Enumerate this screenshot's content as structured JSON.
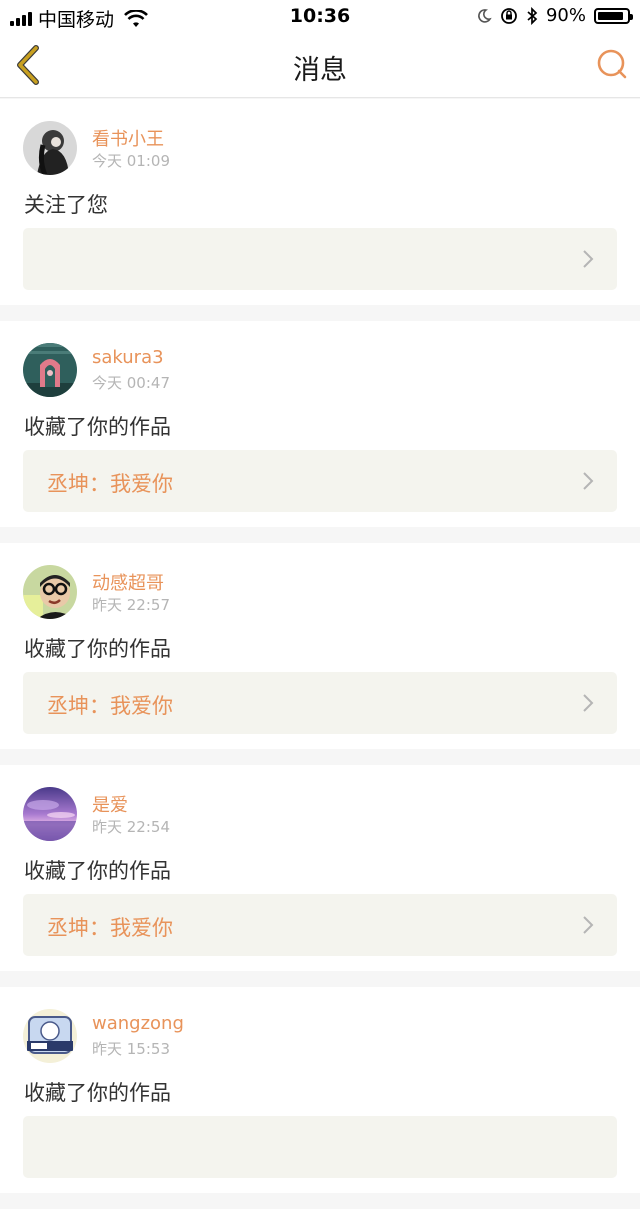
{
  "status_bar": {
    "carrier": "中国移动",
    "time": "10:36",
    "battery_percent_label": "90%",
    "battery_level": 0.9
  },
  "nav": {
    "title": "消息",
    "back_icon": "chevron-left-icon",
    "search_icon": "search-icon"
  },
  "colors": {
    "accent": "#e8935a",
    "back_icon": "#c8a020",
    "quote_bg": "#f4f4ee"
  },
  "messages": [
    {
      "username": "看书小王",
      "time": "今天 01:09",
      "action": "关注了您",
      "quote": ""
    },
    {
      "username": "sakura3",
      "time": "今天 00:47",
      "action": "收藏了你的作品",
      "quote": "丞坤：我爱你"
    },
    {
      "username": "动感超哥",
      "time": "昨天 22:57",
      "action": "收藏了你的作品",
      "quote": "丞坤：我爱你"
    },
    {
      "username": "是爱",
      "time": "昨天 22:54",
      "action": "收藏了你的作品",
      "quote": "丞坤：我爱你"
    },
    {
      "username": "wangzong",
      "time": "昨天 15:53",
      "action": "收藏了你的作品",
      "quote": ""
    }
  ]
}
